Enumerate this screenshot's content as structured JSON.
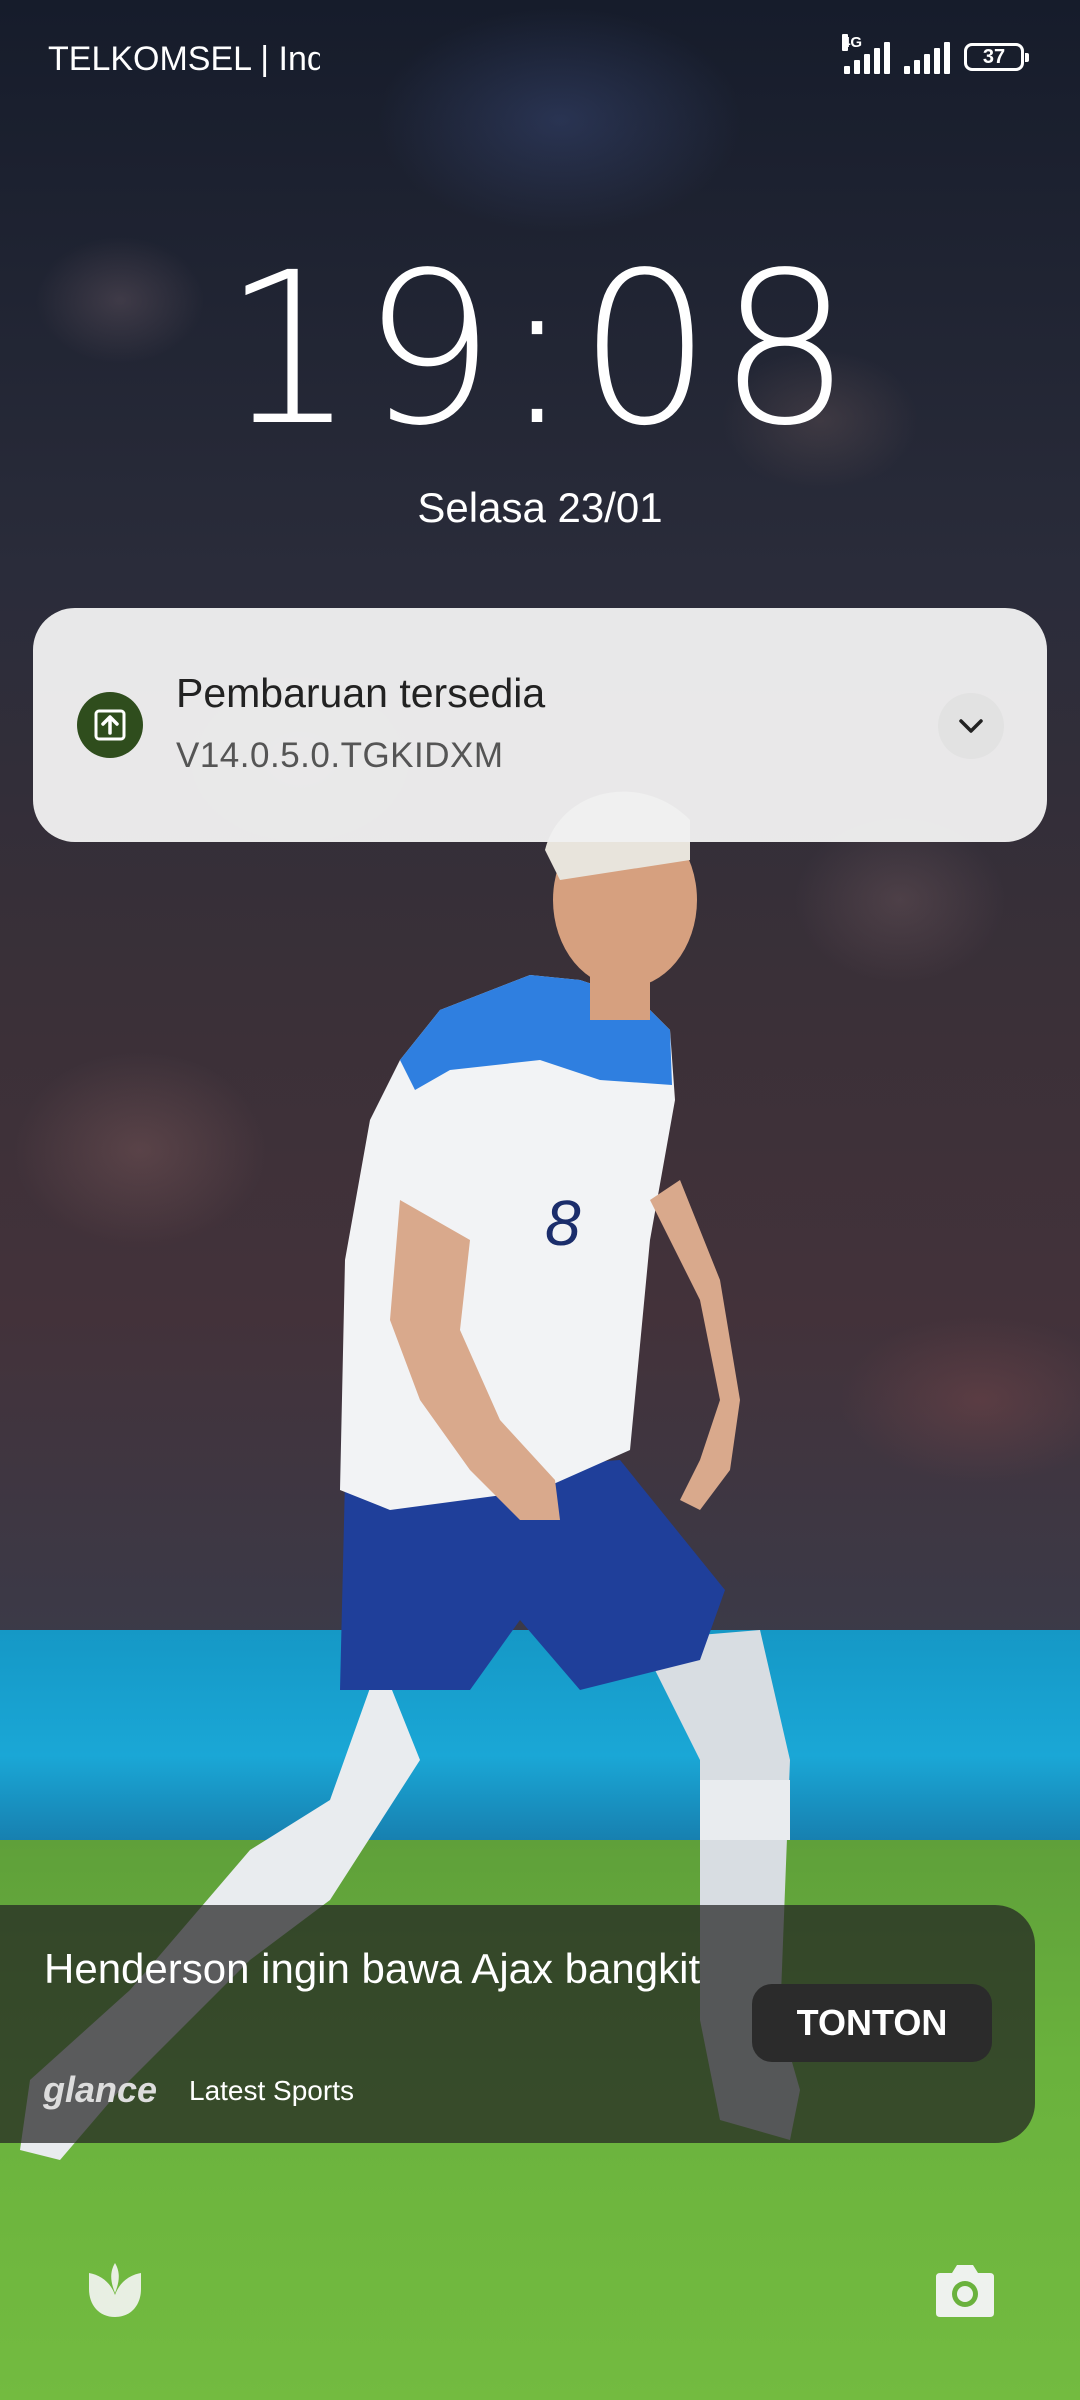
{
  "status_bar": {
    "carrier": "TELKOMSEL | Indosat",
    "network_type": "4G",
    "battery_level": "37"
  },
  "lock_screen": {
    "time": "19:08",
    "date": "Selasa 23/01"
  },
  "notification": {
    "title": "Pembaruan tersedia",
    "subtitle": "V14.0.5.0.TGKIDXM",
    "icon": "upload-arrow-icon",
    "accent_color": "#2f4d1d"
  },
  "glance": {
    "headline": "Henderson ingin bawa Ajax bangkit",
    "brand": "glance",
    "category": "Latest Sports",
    "button_label": "TONTON"
  },
  "shortcuts": {
    "left_icon": "glance-petal-icon",
    "right_icon": "camera-icon"
  }
}
